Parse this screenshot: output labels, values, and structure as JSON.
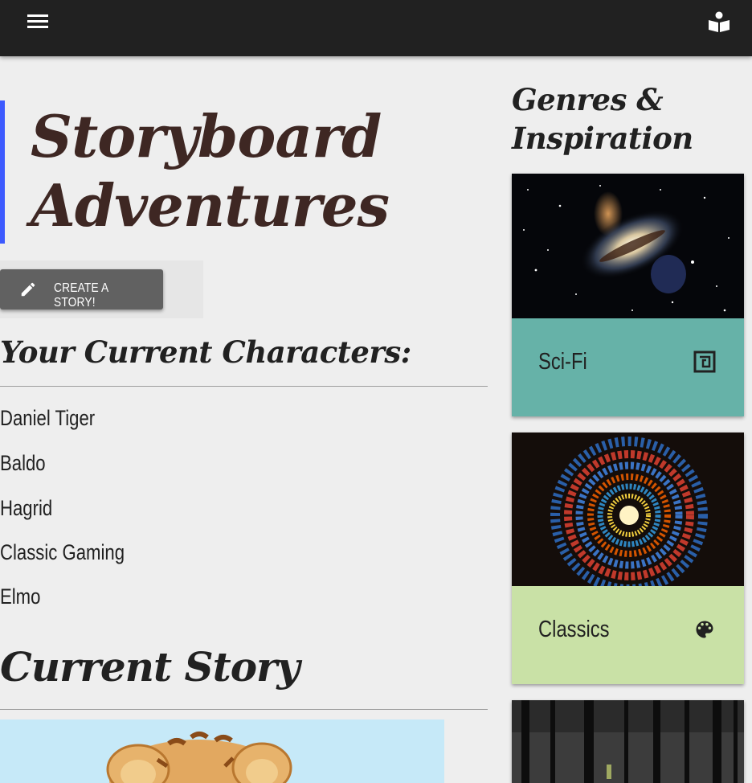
{
  "header": {
    "menu_icon": "hamburger-menu-icon",
    "reader_icon": "chrome-reader-icon",
    "bg_color": "#212121"
  },
  "main": {
    "title_line1": "Storyboard",
    "title_line2": "Adventures",
    "accent_color": "#3d5afe",
    "create_button": {
      "icon": "pencil-icon",
      "label": "CREATE A STORY!"
    },
    "characters_heading": "Your Current Characters:",
    "characters": [
      "Daniel Tiger",
      "Baldo",
      "Hagrid",
      "Classic Gaming",
      "Elmo"
    ],
    "story_heading": "Current Story"
  },
  "sidebar": {
    "heading_line1": "Genres &",
    "heading_line2": "Inspiration",
    "cards": [
      {
        "name": "Sci-Fi",
        "icon": "memory-chip-icon",
        "color": "#66b2a8"
      },
      {
        "name": "Classics",
        "icon": "palette-icon",
        "color": "#c9e1a6"
      },
      {
        "name": "",
        "icon": "",
        "color": "#1e1e1e"
      }
    ]
  }
}
